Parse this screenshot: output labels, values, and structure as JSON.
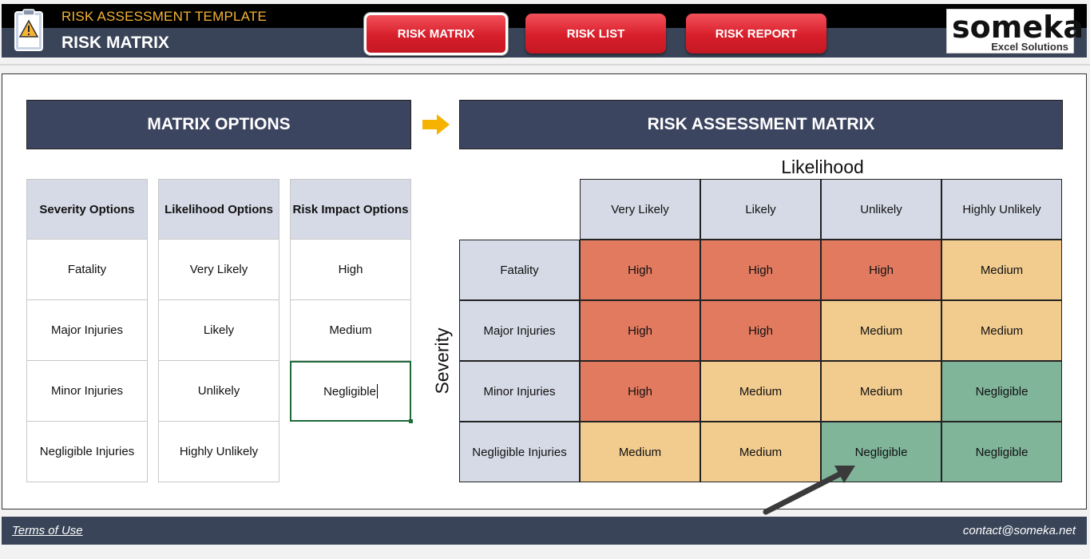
{
  "header": {
    "subtitle": "RISK ASSESSMENT TEMPLATE",
    "title": "RISK MATRIX",
    "nav": [
      {
        "label": "RISK MATRIX",
        "active": true
      },
      {
        "label": "RISK LIST",
        "active": false
      },
      {
        "label": "RISK REPORT",
        "active": false
      }
    ],
    "brand": {
      "name": "someka",
      "sub": "Excel Solutions"
    }
  },
  "options": {
    "banner": "MATRIX OPTIONS",
    "columns": [
      {
        "header": "Severity Options",
        "items": [
          "Fatality",
          "Major Injuries",
          "Minor Injuries",
          "Negligible Injuries"
        ]
      },
      {
        "header": "Likelihood Options",
        "items": [
          "Very Likely",
          "Likely",
          "Unlikely",
          "Highly Unlikely"
        ]
      },
      {
        "header": "Risk Impact Options",
        "items": [
          "High",
          "Medium",
          "Negligible"
        ]
      }
    ]
  },
  "matrix": {
    "banner": "RISK ASSESSMENT MATRIX",
    "likelihood_label": "Likelihood",
    "severity_label": "Severity",
    "likelihood": [
      "Very Likely",
      "Likely",
      "Unlikely",
      "Highly Unlikely"
    ],
    "rows": [
      {
        "severity": "Fatality",
        "cells": [
          "High",
          "High",
          "High",
          "Medium"
        ]
      },
      {
        "severity": "Major Injuries",
        "cells": [
          "High",
          "High",
          "Medium",
          "Medium"
        ]
      },
      {
        "severity": "Minor Injuries",
        "cells": [
          "High",
          "Medium",
          "Medium",
          "Negligible"
        ]
      },
      {
        "severity": "Negligible Injuries",
        "cells": [
          "Medium",
          "Medium",
          "Negligible",
          "Negligible"
        ]
      }
    ]
  },
  "colors": {
    "high": "#e17a5f",
    "medium": "#f2cc8f",
    "negligible": "#80b59a",
    "accent": "#f5b335",
    "nav": "#d71f2b"
  },
  "footer": {
    "terms": "Terms of Use",
    "contact": "contact@someka.net"
  }
}
